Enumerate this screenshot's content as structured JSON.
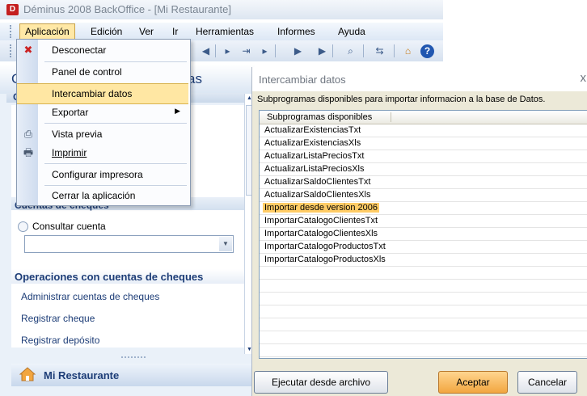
{
  "window": {
    "title": "Déminus 2008 BackOffice - [Mi Restaurante]"
  },
  "menubar": [
    "Aplicación",
    "Edición",
    "Ver",
    "Ir",
    "Herramientas",
    "Informes",
    "Ayuda"
  ],
  "app_menu": {
    "items": [
      {
        "label": "Desconectar",
        "icon": "disconnect-icon"
      },
      {
        "label": "Panel de control"
      },
      {
        "label": "Intercambiar datos",
        "highlighted": true
      },
      {
        "label": "Exportar",
        "submenu": true
      },
      {
        "label": "Vista previa",
        "icon": "print-preview-icon"
      },
      {
        "label": "Imprimir",
        "icon": "printer-icon"
      },
      {
        "label": "Configurar impresora"
      },
      {
        "label": "Cerrar la aplicación"
      }
    ]
  },
  "task_pane": {
    "header_fragment_left": "C",
    "header_fragment_right": "as",
    "sub_fragment": "C",
    "section_cheques": "Cuentas de cheques",
    "radio_label": "Consultar cuenta",
    "combo_value": "",
    "operations_title": "Operaciones con cuentas de cheques",
    "links": [
      "Administrar cuentas de cheques",
      "Registrar cheque",
      "Registrar depósito"
    ],
    "footer_label": "Mi Restaurante"
  },
  "dialog": {
    "title": "Intercambiar datos",
    "close_glyph": "x",
    "description": "Subprogramas disponibles para importar informacion a la base de Datos.",
    "column_header": "Subprogramas disponibles",
    "items": [
      "ActualizarExistenciasTxt",
      "ActualizarExistenciasXls",
      "ActualizarListaPreciosTxt",
      "ActualizarListaPreciosXls",
      "ActualizarSaldoClientesTxt",
      "ActualizarSaldoClientesXls",
      "Importar desde version 2006",
      "ImportarCatalogoClientesTxt",
      "ImportarCatalogoClientesXls",
      "ImportarCatalogoProductosTxt",
      "ImportarCatalogoProductosXls"
    ],
    "selected_item": "Importar desde version 2006",
    "buttons": {
      "run_from_file": "Ejecutar desde archivo",
      "accept": "Aceptar",
      "cancel": "Cancelar"
    }
  },
  "colors": {
    "accent": "#1d3d77",
    "highlight": "#ffe7a3",
    "selection": "#ffcc66"
  }
}
